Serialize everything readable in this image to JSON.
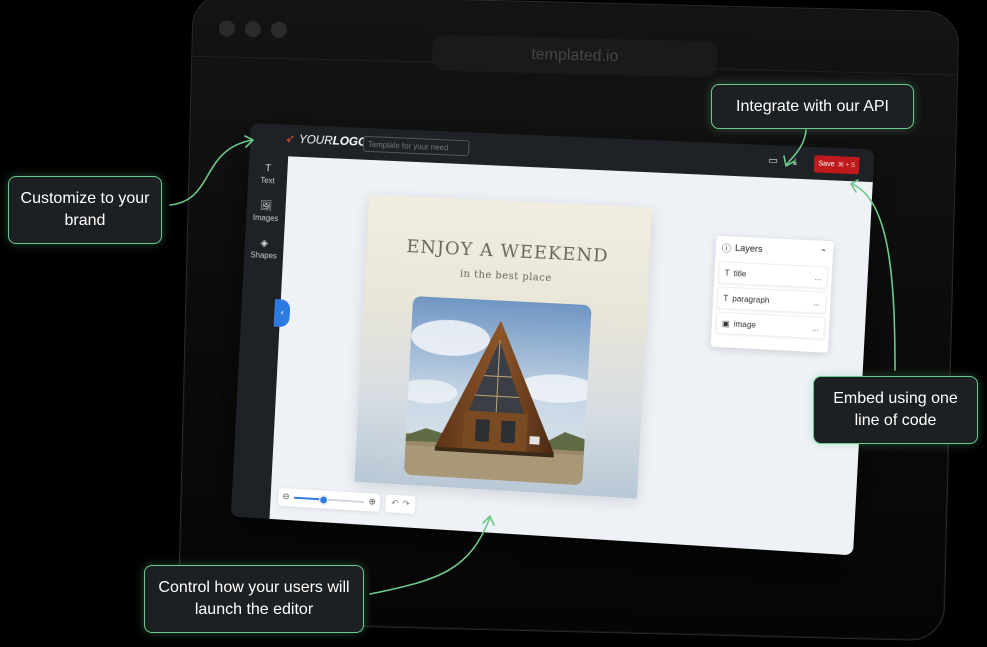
{
  "browser": {
    "url": "templated.io"
  },
  "editor": {
    "logo": {
      "your": "YOUR",
      "logo": "LOGO"
    },
    "template_placeholder": "Template for your need",
    "save": {
      "label": "Save",
      "shortcut": "⌘ + S"
    },
    "sidebar": [
      {
        "label": "Text",
        "icon": "T"
      },
      {
        "label": "Images",
        "icon": "🖼"
      },
      {
        "label": "Shapes",
        "icon": "◈"
      }
    ],
    "poster": {
      "title": "ENJOY A WEEKEND",
      "subtitle": "in the best place"
    },
    "layers": {
      "title": "Layers",
      "items": [
        {
          "label": "title",
          "icon": "T"
        },
        {
          "label": "paragraph",
          "icon": "T"
        },
        {
          "label": "image",
          "icon": "▣"
        }
      ],
      "more": "..."
    },
    "zoom": {
      "level": 0.42
    }
  },
  "callouts": {
    "customize": "Customize to your brand",
    "api": "Integrate with our API",
    "embed": "Embed using one line of code",
    "control": "Control how your users will launch the editor"
  },
  "colors": {
    "accent_green": "#6cc98a",
    "save_red": "#c0191b",
    "primary_blue": "#2d7be0"
  }
}
